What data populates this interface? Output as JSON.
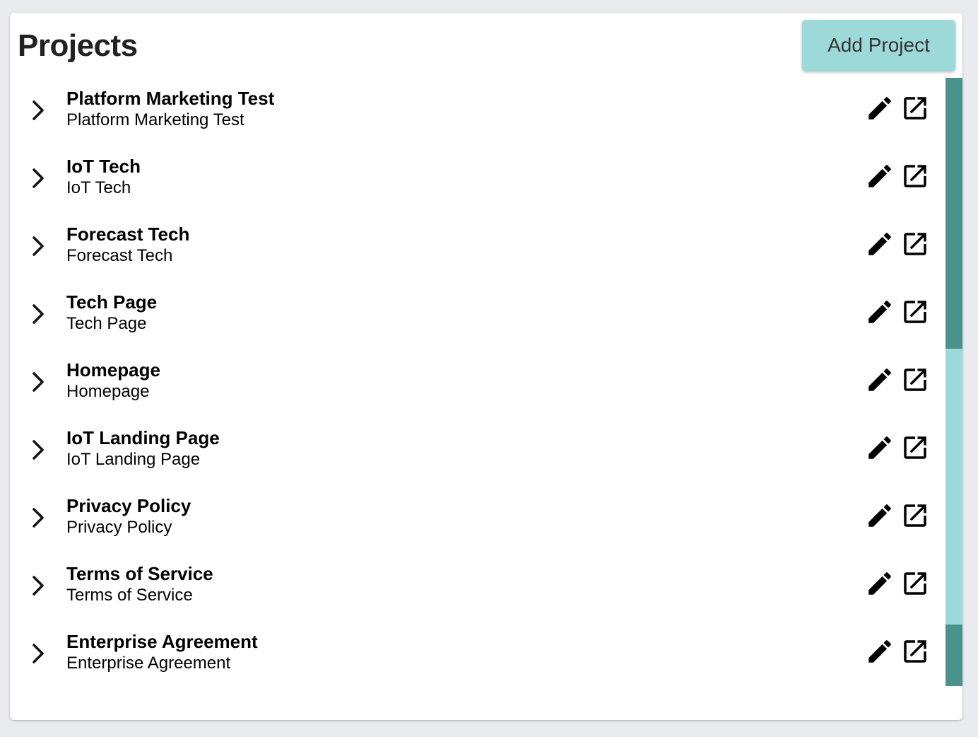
{
  "header": {
    "title": "Projects",
    "add_button_label": "Add Project"
  },
  "projects": [
    {
      "name": "Platform Marketing Test",
      "description": "Platform Marketing Test"
    },
    {
      "name": "IoT Tech",
      "description": "IoT Tech"
    },
    {
      "name": "Forecast Tech",
      "description": "Forecast Tech"
    },
    {
      "name": "Tech Page",
      "description": "Tech Page"
    },
    {
      "name": "Homepage",
      "description": "Homepage"
    },
    {
      "name": "IoT Landing Page",
      "description": "IoT Landing Page"
    },
    {
      "name": "Privacy Policy",
      "description": "Privacy Policy"
    },
    {
      "name": "Terms of Service",
      "description": "Terms of Service"
    },
    {
      "name": "Enterprise Agreement",
      "description": "Enterprise Agreement"
    }
  ],
  "row_icons": [
    "chevron-right-icon",
    "pencil-icon",
    "open-in-new-icon"
  ],
  "colors": {
    "accent": "#9ed9d9",
    "scroll_thumb": "#4a928c",
    "background": "#e9ebef"
  }
}
